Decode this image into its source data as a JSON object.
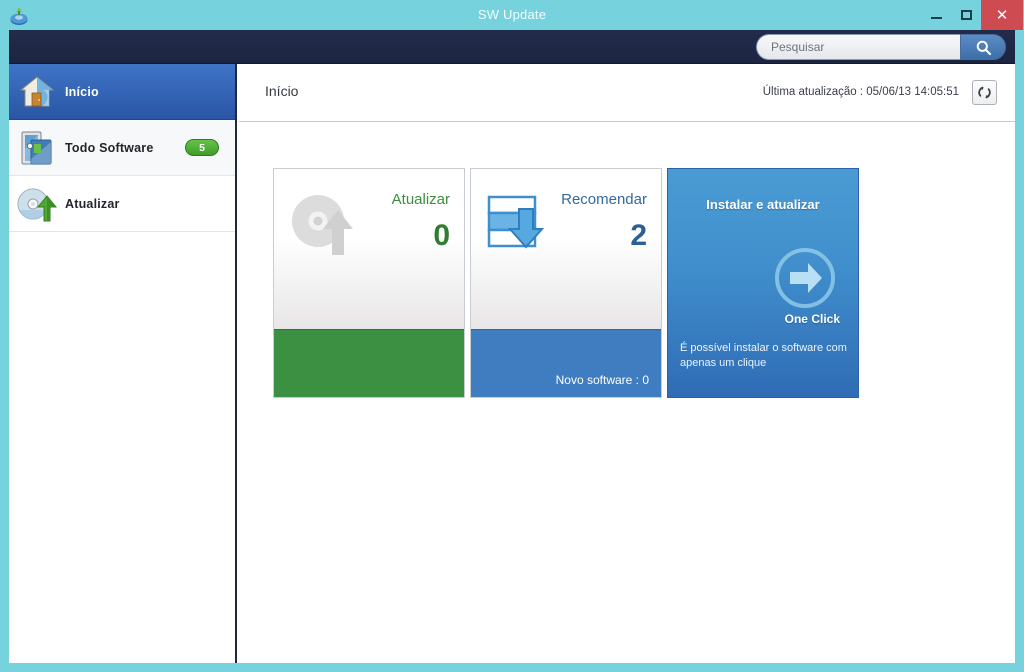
{
  "window": {
    "title": "SW Update",
    "app_icon": "sw-update-icon",
    "controls": {
      "minimize": "minimize-icon",
      "maximize": "maximize-icon",
      "close": "close-icon"
    },
    "frame_color": "#76d2dd",
    "close_color": "#cf4b52"
  },
  "toolbar": {
    "background": "#1e2745",
    "search": {
      "placeholder": "Pesquisar",
      "value": "",
      "button_icon": "search-icon"
    }
  },
  "sidebar": {
    "items": [
      {
        "label": "Início",
        "icon": "home-icon",
        "selected": true,
        "badge": null
      },
      {
        "label": "Todo Software",
        "icon": "all-software-icon",
        "selected": false,
        "badge": "5"
      },
      {
        "label": "Atualizar",
        "icon": "update-disc-icon",
        "selected": false,
        "badge": null
      }
    ],
    "badge_color": "#4da72f",
    "selected_color": "#2f5fb0"
  },
  "content": {
    "page_title": "Início",
    "last_update_label": "Última atualização : 05/06/13 14:05:51",
    "refresh_icon": "refresh-icon"
  },
  "cards": {
    "update": {
      "title": "Atualizar",
      "count": "0",
      "icon": "update-disc-icon",
      "band_text": "",
      "accent": "#3c9041",
      "title_color": "#3e8e3e"
    },
    "recommend": {
      "title": "Recomendar",
      "count": "2",
      "icon": "download-box-icon",
      "band_text": "Novo software : 0",
      "accent": "#3f7dc0",
      "title_color": "#33699f"
    },
    "oneclick": {
      "title": "Instalar e atualizar",
      "label": "One Click",
      "description": "É possível instalar o software com apenas um clique",
      "icon": "arrow-right-circle-icon",
      "accent": "#3f86c9"
    }
  }
}
